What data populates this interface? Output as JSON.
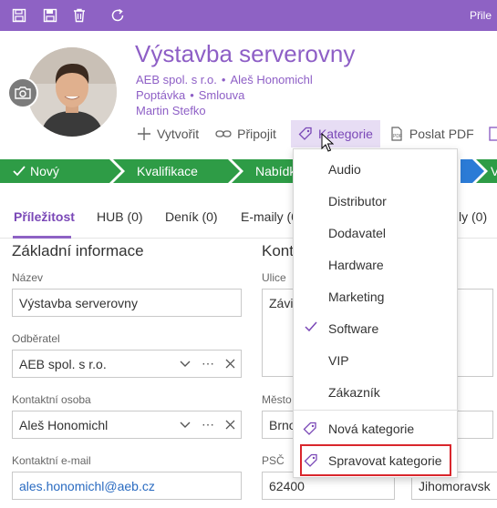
{
  "toolbar": {
    "icons": [
      "save-icon",
      "save-close-icon",
      "delete-icon",
      "refresh-icon"
    ],
    "right_text": "Přile"
  },
  "record": {
    "title": "Výstavba serverovny",
    "line1": {
      "company": "AEB spol. s r.o.",
      "contact": "Aleš Honomichl"
    },
    "line2": {
      "type": "Poptávka",
      "relation": "Smlouva"
    },
    "owner": "Martin Stefko"
  },
  "actions": {
    "create": "Vytvořit",
    "attach": "Připojit",
    "category": "Kategorie",
    "send_pdf": "Poslat PDF"
  },
  "pipeline": {
    "stages": [
      "Nový",
      "Kvalifikace",
      "Nabídk",
      "V"
    ],
    "colors": {
      "done": "#2e9c46",
      "current": "#2b7bd6"
    }
  },
  "tabs": {
    "items": [
      "Příležitost",
      "HUB (0)",
      "Deník (0)",
      "E-maily (0",
      "ly (0)"
    ],
    "active": "Příležitost"
  },
  "left_section": {
    "title": "Základní informace",
    "name_label": "Název",
    "name_value": "Výstavba serverovny",
    "customer_label": "Odběratel",
    "customer_value": "AEB spol. s r.o.",
    "contact_label": "Kontaktní osoba",
    "contact_value": "Aleš Honomichl",
    "email_label": "Kontaktní e-mail",
    "email_value": "ales.honomichl@aeb.cz"
  },
  "right_section": {
    "title": "Kont",
    "street_label": "Ulice",
    "street_value": "Závis",
    "city_label": "Město",
    "city_value": "Brno",
    "zip_label": "PSČ",
    "zip_value": "62400",
    "region_value": "Jihomoravsk"
  },
  "category_menu": {
    "items": [
      "Audio",
      "Distributor",
      "Dodavatel",
      "Hardware",
      "Marketing",
      "Software",
      "VIP",
      "Zákazník"
    ],
    "checked": "Software",
    "new_category": "Nová kategorie",
    "manage_categories": "Spravovat kategorie"
  },
  "colors": {
    "brand": "#8e62c4",
    "accent_text": "#8e5fc6",
    "highlight_border": "#d9262c",
    "link": "#2a6bc1"
  }
}
